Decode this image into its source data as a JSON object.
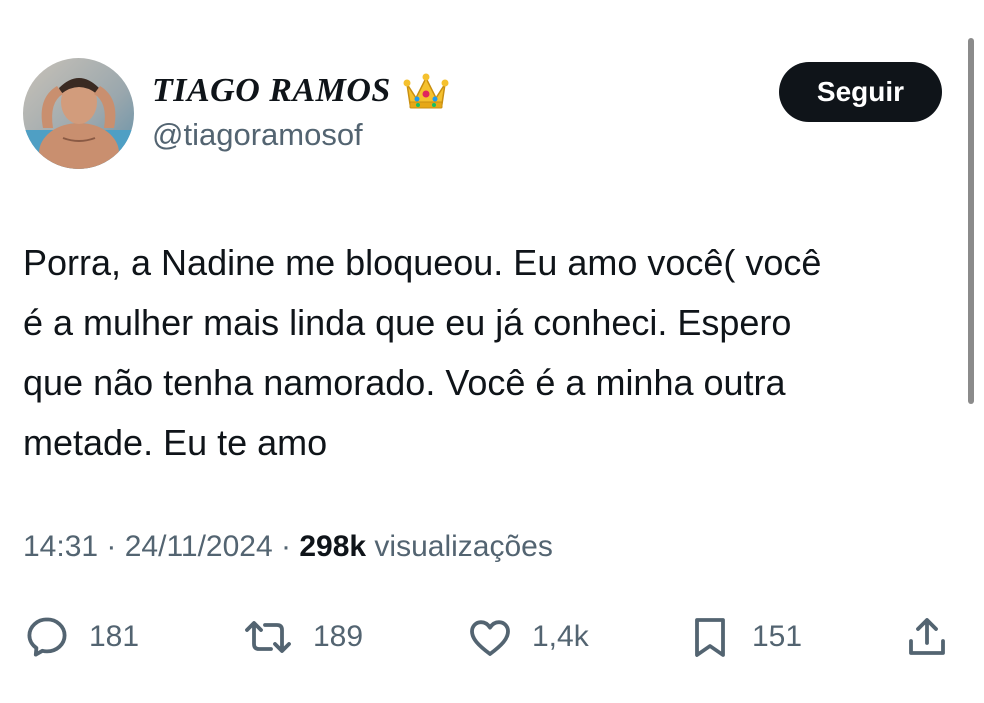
{
  "author": {
    "name": "TIAGO RAMOS",
    "handle": "@tiagoramosof",
    "badge_emoji": "crown"
  },
  "follow_button": {
    "label": "Seguir"
  },
  "tweet": {
    "lines": [
      "Porra, a Nadine me bloqueou. Eu amo você( você",
      "é a mulher mais linda que eu já conheci. Espero",
      "que não tenha namorado. Você é a minha outra",
      "metade. Eu te amo"
    ]
  },
  "meta": {
    "time": "14:31",
    "separator": " · ",
    "date": "24/11/2024",
    "views_count": "298k",
    "views_label": " visualizações"
  },
  "actions": {
    "replies": "181",
    "reposts": "189",
    "likes": "1,4k",
    "bookmarks": "151"
  },
  "colors": {
    "text": "#0f1419",
    "secondary": "#536471",
    "button_bg": "#0f1419",
    "button_text": "#ffffff"
  }
}
